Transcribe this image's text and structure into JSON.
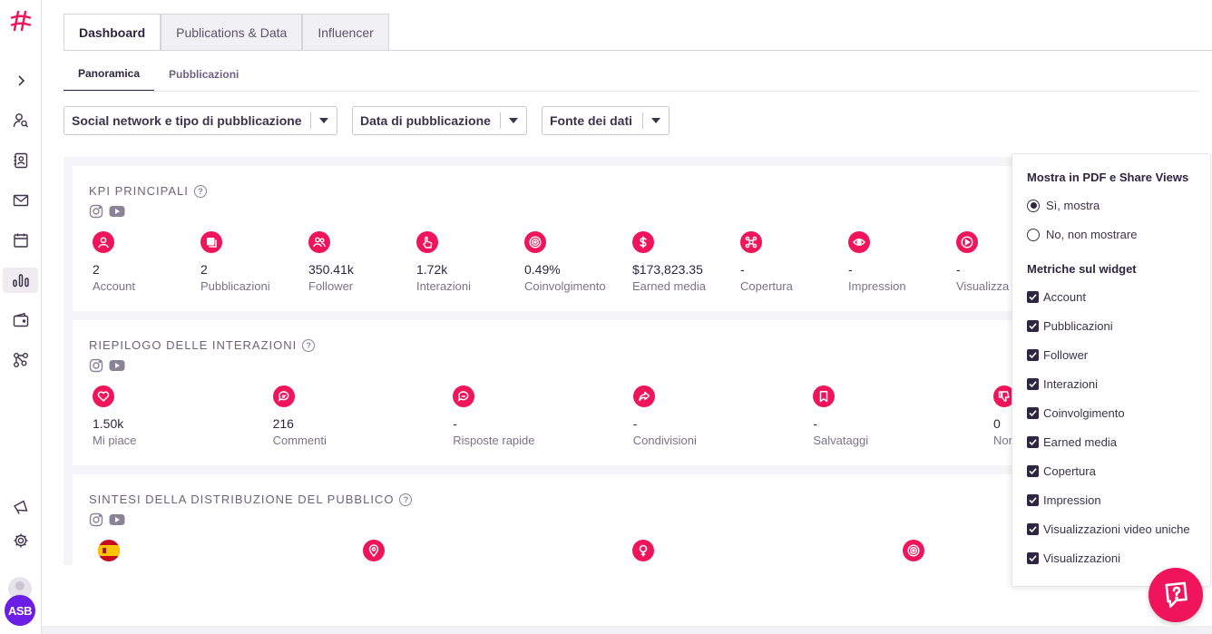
{
  "tabs": [
    "Dashboard",
    "Publications & Data",
    "Influencer"
  ],
  "subtabs": [
    "Panoramica",
    "Pubblicazioni"
  ],
  "filters": [
    "Social network e tipo di pubblicazione",
    "Data di pubblicazione",
    "Fonte dei dati"
  ],
  "kpi": {
    "title": "KPI PRINCIPALI",
    "metrics": [
      {
        "value": "2",
        "label": "Account",
        "icon": "user-icon"
      },
      {
        "value": "2",
        "label": "Pubblicazioni",
        "icon": "publications-icon"
      },
      {
        "value": "350.41k",
        "label": "Follower",
        "icon": "followers-icon"
      },
      {
        "value": "1.72k",
        "label": "Interazioni",
        "icon": "tap-icon"
      },
      {
        "value": "0.49%",
        "label": "Coinvolgimento",
        "icon": "target-icon"
      },
      {
        "value": "$173,823.35",
        "label": "Earned media",
        "icon": "dollar-icon"
      },
      {
        "value": "-",
        "label": "Copertura",
        "icon": "network-icon"
      },
      {
        "value": "-",
        "label": "Impression",
        "icon": "eye-icon"
      },
      {
        "value": "-",
        "label": "Visualizza",
        "icon": "play-icon"
      }
    ]
  },
  "interactions": {
    "title": "RIEPILOGO DELLE INTERAZIONI",
    "metrics": [
      {
        "value": "1.50k",
        "label": "Mi piace",
        "icon": "heart-icon"
      },
      {
        "value": "216",
        "label": "Commenti",
        "icon": "comment-icon"
      },
      {
        "value": "-",
        "label": "Risposte rapide",
        "icon": "quick-reply-icon"
      },
      {
        "value": "-",
        "label": "Condivisioni",
        "icon": "share-icon"
      },
      {
        "value": "-",
        "label": "Salvataggi",
        "icon": "bookmark-icon"
      },
      {
        "value": "0",
        "label": "Nor",
        "icon": "dislike-icon"
      }
    ]
  },
  "audience": {
    "title": "SINTESI DELLA DISTRIBUZIONE DEL PUBBLICO"
  },
  "panel": {
    "show_title": "Mostra in PDF e Share Views",
    "radio_yes": "Sì, mostra",
    "radio_no": "No, non mostrare",
    "metrics_title": "Metriche sul widget",
    "checks": [
      "Account",
      "Pubblicazioni",
      "Follower",
      "Interazioni",
      "Coinvolgimento",
      "Earned media",
      "Copertura",
      "Impression",
      "Visualizzazioni video uniche",
      "Visualizzazioni"
    ]
  },
  "user": {
    "initials": "ASB"
  },
  "colors": {
    "accent": "#f0145a",
    "primary": "#2d2640",
    "avatar": "#6b1ee6"
  }
}
